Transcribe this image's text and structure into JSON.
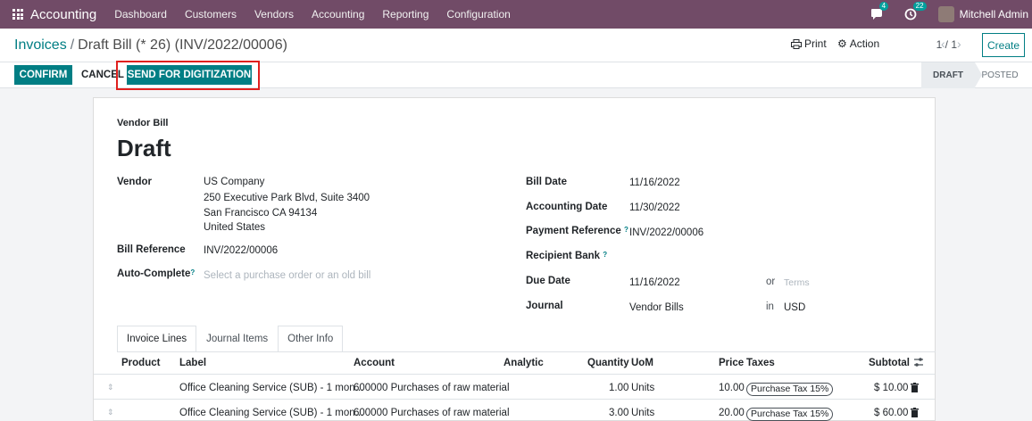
{
  "navbar": {
    "brand": "Accounting",
    "menu": [
      "Dashboard",
      "Customers",
      "Vendors",
      "Accounting",
      "Reporting",
      "Configuration"
    ],
    "chat_count": "4",
    "activity_count": "22",
    "user": "Mitchell Admin"
  },
  "control_panel": {
    "breadcrumb_parent": "Invoices",
    "breadcrumb_separator": "/",
    "breadcrumb_current": "Draft Bill (* 26) (INV/2022/00006)",
    "print": "Print",
    "action": "Action",
    "pager": "1 / 1",
    "create": "Create"
  },
  "statusbar": {
    "confirm": "CONFIRM",
    "cancel": "CANCEL",
    "send_digitization": "SEND FOR DIGITIZATION",
    "stages": [
      "DRAFT",
      "POSTED"
    ],
    "active_stage": "DRAFT"
  },
  "form": {
    "doc_type": "Vendor Bill",
    "title": "Draft",
    "vendor_label": "Vendor",
    "vendor_lines": [
      "US Company",
      "250 Executive Park Blvd, Suite 3400",
      "San Francisco CA 94134",
      "United States"
    ],
    "bill_ref_label": "Bill Reference",
    "bill_ref": "INV/2022/00006",
    "autocomplete_label": "Auto-Complete",
    "autocomplete_placeholder": "Select a purchase order or an old bill",
    "bill_date_label": "Bill Date",
    "bill_date": "11/16/2022",
    "accounting_date_label": "Accounting Date",
    "accounting_date": "11/30/2022",
    "payment_ref_label": "Payment Reference",
    "payment_ref": "INV/2022/00006",
    "recipient_bank_label": "Recipient Bank",
    "due_date_label": "Due Date",
    "due_date": "11/16/2022",
    "or_text": "or",
    "terms_placeholder": "Terms",
    "journal_label": "Journal",
    "journal": "Vendor Bills",
    "in_text": "in",
    "currency": "USD",
    "help_mark": "?"
  },
  "tabs": [
    "Invoice Lines",
    "Journal Items",
    "Other Info"
  ],
  "lines": {
    "headers": {
      "product": "Product",
      "label": "Label",
      "account": "Account",
      "analytic": "Analytic",
      "quantity": "Quantity",
      "uom": "UoM",
      "price": "Price",
      "taxes": "Taxes",
      "subtotal": "Subtotal"
    },
    "rows": [
      {
        "label": "Office Cleaning Service (SUB) - 1 mon...",
        "account": "600000 Purchases of raw material",
        "quantity": "1.00",
        "uom": "Units",
        "price": "10.00",
        "tax": "Purchase Tax 15%",
        "subtotal": "$ 10.00"
      },
      {
        "label": "Office Cleaning Service (SUB) - 1 mon...",
        "account": "600000 Purchases of raw material",
        "quantity": "3.00",
        "uom": "Units",
        "price": "20.00",
        "tax": "Purchase Tax 15%",
        "subtotal": "$ 60.00"
      }
    ]
  }
}
